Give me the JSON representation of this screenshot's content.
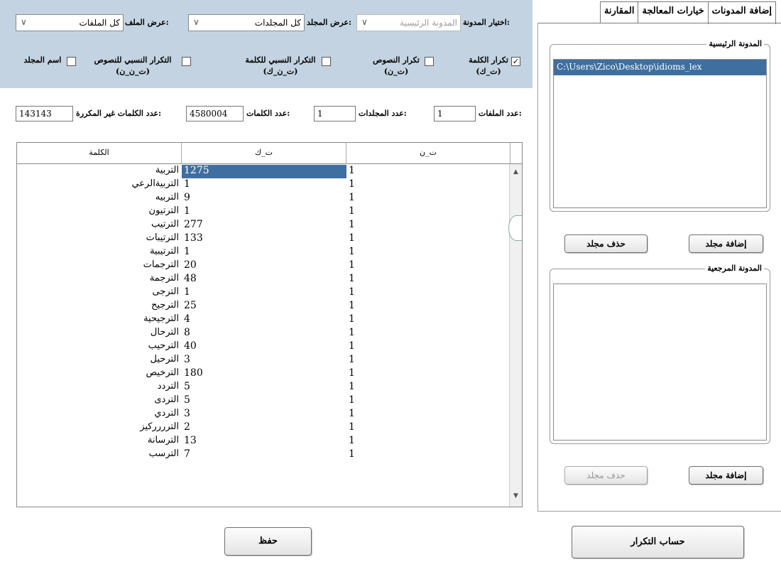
{
  "tabs": [
    {
      "label": "إضافة المدونات",
      "active": true
    },
    {
      "label": "خيارات المعالجة",
      "active": false
    },
    {
      "label": "المقارنة",
      "active": false
    }
  ],
  "main_corpus": {
    "title": "المدونة الرئيسية",
    "items": [
      "C:\\Users\\Zico\\Desktop\\idioms_lex"
    ],
    "add_button": "إضافة مجلد",
    "remove_button": "حذف مجلد"
  },
  "reference_corpus": {
    "title": "المدونة المرجعية",
    "items": [],
    "add_button": "إضافة مجلد",
    "remove_button": "حذف مجلد"
  },
  "compute_button": "حساب التكرار",
  "options": {
    "corpus_select_label": "اختيار المدونة:",
    "corpus_select_value": "المدونة الرئيسية",
    "folder_view_label": "عرض المجلد:",
    "folder_view_value": "كل المجلدات",
    "file_view_label": "عرض الملف:",
    "file_view_value": "كل الملفات",
    "checkboxes": [
      {
        "label": "تكرار الكلمة",
        "sub": "(ت_ك)",
        "checked": true
      },
      {
        "label": "تكرار النصوص",
        "sub": "(ت_ن)",
        "checked": false
      },
      {
        "label": "التكرار النسبي للكلمة",
        "sub": "(ت_ن_ك)",
        "checked": false
      },
      {
        "label": "التكرار النسبي للنصوص",
        "sub": "(ت_ن_ن)",
        "checked": false
      },
      {
        "label": "اسم المجلد",
        "sub": "",
        "checked": false
      }
    ]
  },
  "stats": {
    "files_label": "عدد الملفات:",
    "files_value": "1",
    "folders_label": "عدد المجلدات:",
    "folders_value": "1",
    "words_label": "عدد الكلمات:",
    "words_value": "4580004",
    "unique_label": "عدد الكلمات غير المكررة:",
    "unique_value": "143143"
  },
  "table": {
    "columns": [
      "الكلمة",
      "ت_ك",
      "ت_ن"
    ],
    "rows": [
      [
        "التربية",
        "1275",
        "1"
      ],
      [
        "التربيةالرعي",
        "1",
        "1"
      ],
      [
        "التربيه",
        "9",
        "1"
      ],
      [
        "الترتيون",
        "1",
        "1"
      ],
      [
        "الترتيب",
        "277",
        "1"
      ],
      [
        "الترتيبات",
        "133",
        "1"
      ],
      [
        "الترتيبية",
        "1",
        "1"
      ],
      [
        "الترجمات",
        "20",
        "1"
      ],
      [
        "الترجمة",
        "48",
        "1"
      ],
      [
        "الترجى",
        "1",
        "1"
      ],
      [
        "الترجيح",
        "25",
        "1"
      ],
      [
        "الترجيحية",
        "4",
        "1"
      ],
      [
        "الترحال",
        "8",
        "1"
      ],
      [
        "الترحيب",
        "40",
        "1"
      ],
      [
        "الترحيل",
        "3",
        "1"
      ],
      [
        "الترخيص",
        "180",
        "1"
      ],
      [
        "التردد",
        "5",
        "1"
      ],
      [
        "التردى",
        "5",
        "1"
      ],
      [
        "التردي",
        "3",
        "1"
      ],
      [
        "الترررركيز",
        "2",
        "1"
      ],
      [
        "الترسانة",
        "13",
        "1"
      ],
      [
        "الترسب",
        "7",
        "1"
      ]
    ]
  },
  "save_button": "حفظ"
}
